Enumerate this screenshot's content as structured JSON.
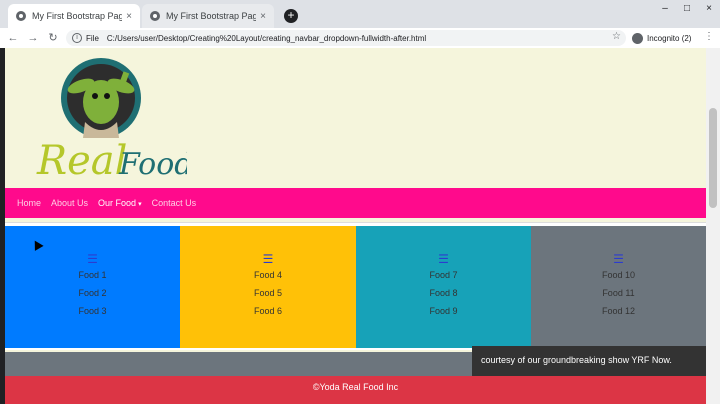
{
  "browser": {
    "tabs": [
      {
        "title": "My First Bootstrap Page",
        "close": "×"
      },
      {
        "title": "My First Bootstrap Page",
        "close": "×"
      }
    ],
    "new_tab": "+",
    "window_controls": [
      "–",
      "□",
      "×"
    ],
    "back": "←",
    "forward": "→",
    "reload": "↻",
    "address_label": "File",
    "url": "C:/Users/user/Desktop/Creating%20Layout/creating_navbar_dropdown-fullwidth-after.html",
    "star": "☆",
    "profile": "Incognito (2)",
    "menu": "⋮"
  },
  "site": {
    "logo_text": "Real Food",
    "nav": [
      {
        "label": "Home",
        "active": false
      },
      {
        "label": "About Us",
        "active": false
      },
      {
        "label": "Our Food",
        "active": true,
        "caret": "▾"
      },
      {
        "label": "Contact Us",
        "active": false
      }
    ],
    "dropdown_columns": [
      {
        "icon": "☰",
        "items": [
          "Food 1",
          "Food 2",
          "Food 3"
        ],
        "color": "#007bff"
      },
      {
        "icon": "☰",
        "items": [
          "Food 4",
          "Food 5",
          "Food 6"
        ],
        "color": "#ffc107"
      },
      {
        "icon": "☰",
        "items": [
          "Food 7",
          "Food 8",
          "Food 9"
        ],
        "color": "#17a2b8"
      },
      {
        "icon": "☰",
        "items": [
          "Food 10",
          "Food 11",
          "Food 12"
        ],
        "color": "#6c757d"
      }
    ],
    "caption": "courtesy of our groundbreaking show YRF Now.",
    "footer": "©Yoda Real Food Inc"
  },
  "colors": {
    "navbar": "#ff0a8c",
    "page_bg": "#f5f5dc",
    "footer": "#dc3545"
  }
}
